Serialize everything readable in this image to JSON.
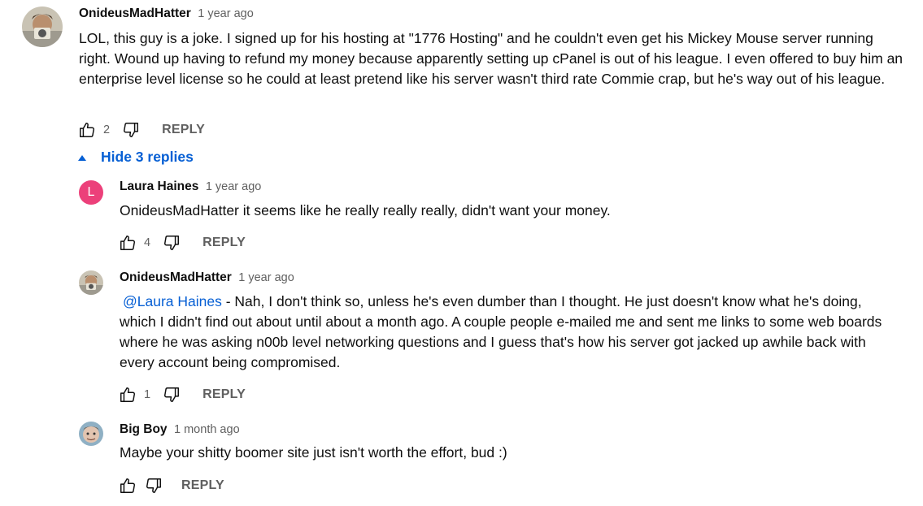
{
  "comments": [
    {
      "author": "OnideusMadHatter",
      "time": "1 year ago",
      "text": "LOL, this guy is a joke. I signed up for his hosting at \"1776 Hosting\" and he couldn't even get his Mickey Mouse server running right. Wound up having to refund my money because apparently setting up cPanel is out of his league. I even offered to buy him an enterprise level license so he could at least pretend like his server wasn't third rate Commie crap, but he's way out of his league.",
      "likes": "2",
      "reply_label": "REPLY"
    }
  ],
  "hide_replies_label": "Hide 3 replies",
  "replies": [
    {
      "author": "Laura Haines",
      "time": "1 year ago",
      "avatar_letter": "L",
      "text": "OnideusMadHatter  it seems like he really really really, didn't want your money.",
      "likes": "4",
      "reply_label": "REPLY"
    },
    {
      "author": "OnideusMadHatter",
      "time": "1 year ago",
      "mention": "@Laura Haines",
      "text": " - Nah, I don't think so, unless he's even dumber than I thought.  He just doesn't know what he's doing, which I didn't find out about until about a month ago.  A couple people e-mailed me and sent me links to some web boards where he was asking n00b level networking questions and I guess that's how his server got jacked up awhile back with every account being compromised.",
      "likes": "1",
      "reply_label": "REPLY"
    },
    {
      "author": "Big Boy",
      "time": "1 month ago",
      "text": "Maybe your shitty boomer site just isn't worth the effort, bud :)",
      "likes": "",
      "reply_label": "REPLY"
    }
  ],
  "icons": {
    "like": "thumb-up-icon",
    "dislike": "thumb-down-icon",
    "collapse": "triangle-up-icon"
  },
  "colors": {
    "link": "#065fd4",
    "secondary_text": "#606060",
    "letter_avatar_bg": "#ec407a"
  }
}
